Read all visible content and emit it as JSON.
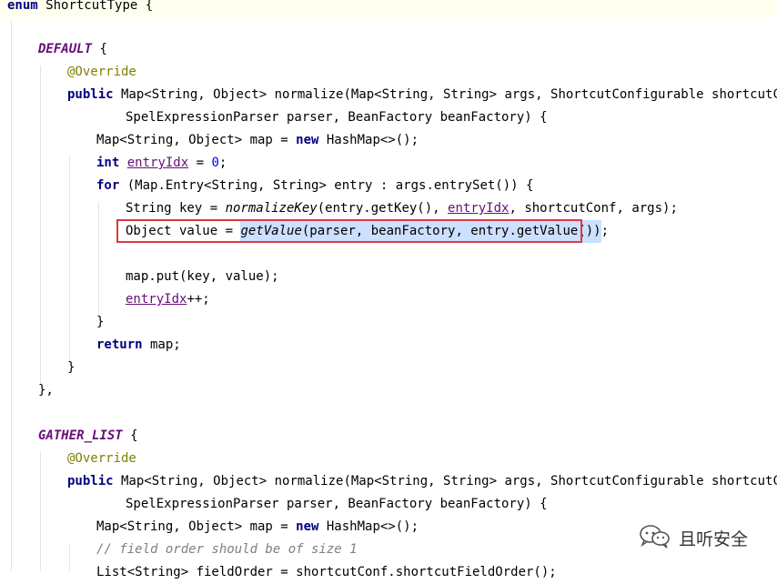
{
  "code": {
    "l0": {
      "kw": "enum",
      "name": "ShortcutType",
      "rest": " {"
    },
    "l2": {
      "const": "DEFAULT",
      "rest": " {"
    },
    "l3": {
      "anno": "@Override"
    },
    "l4": {
      "kw": "public",
      "text": " Map<String, Object> normalize(Map<String, String> args, ShortcutConfigurable shortcutConf,"
    },
    "l5": {
      "text": "SpelExpressionParser parser, BeanFactory beanFactory) {"
    },
    "l6": {
      "a": "Map<String, Object> map = ",
      "kw": "new",
      "b": " HashMap<>();"
    },
    "l7": {
      "kw": "int",
      "field": "entryIdx",
      "eq": " = ",
      "num": "0",
      "end": ";"
    },
    "l8": {
      "kw": "for",
      "text": " (Map.Entry<String, String> entry : args.entrySet()) {"
    },
    "l9": {
      "a": "String key = ",
      "method": "normalizeKey",
      "b": "(entry.getKey(), ",
      "field": "entryIdx",
      "c": ", shortcutConf, args);"
    },
    "l10": {
      "a": "Object value = ",
      "method": "getValue",
      "b": "(parser, beanFactory, entry.getValue())",
      "end": ";"
    },
    "l12": {
      "text": "map.put(key, value);"
    },
    "l13": {
      "field": "entryIdx",
      "end": "++;"
    },
    "l14": {
      "text": "}"
    },
    "l15": {
      "kw": "return",
      "text": " map;"
    },
    "l16": {
      "text": "}"
    },
    "l17": {
      "text": "},"
    },
    "l19": {
      "const": "GATHER_LIST",
      "rest": " {"
    },
    "l20": {
      "anno": "@Override"
    },
    "l21": {
      "kw": "public",
      "text": " Map<String, Object> normalize(Map<String, String> args, ShortcutConfigurable shortcutConf,"
    },
    "l22": {
      "text": "SpelExpressionParser parser, BeanFactory beanFactory) {"
    },
    "l23": {
      "a": "Map<String, Object> map = ",
      "kw": "new",
      "b": " HashMap<>();"
    },
    "l24": {
      "comment": "// field order should be of size 1"
    },
    "l25": {
      "text": "List<String> fieldOrder = shortcutConf.shortcutFieldOrder();"
    }
  },
  "watermark": {
    "text": "且听安全",
    "icon": "wechat-icon"
  }
}
